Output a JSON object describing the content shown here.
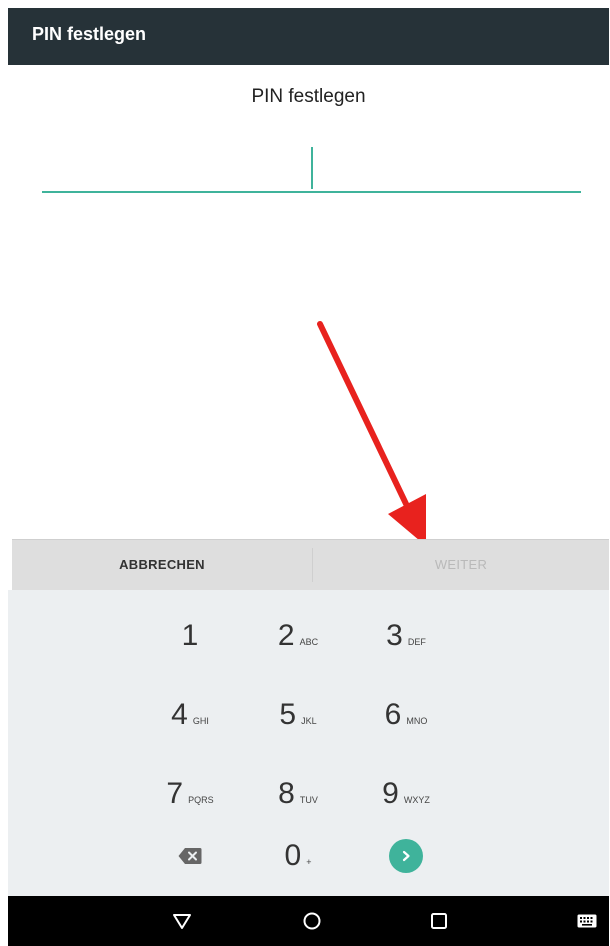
{
  "appbar": {
    "title": "PIN festlegen"
  },
  "prompt": {
    "text": "PIN festlegen"
  },
  "pin_input": {
    "value": ""
  },
  "actions": {
    "cancel_label": "ABBRECHEN",
    "next_label": "WEITER"
  },
  "keypad": {
    "keys": [
      {
        "digit": "1",
        "letters": ""
      },
      {
        "digit": "2",
        "letters": "ABC"
      },
      {
        "digit": "3",
        "letters": "DEF"
      },
      {
        "digit": "4",
        "letters": "GHI"
      },
      {
        "digit": "5",
        "letters": "JKL"
      },
      {
        "digit": "6",
        "letters": "MNO"
      },
      {
        "digit": "7",
        "letters": "PQRS"
      },
      {
        "digit": "8",
        "letters": "TUV"
      },
      {
        "digit": "9",
        "letters": "WXYZ"
      },
      {
        "digit": "0",
        "letters": "+"
      }
    ],
    "backspace_icon": "backspace-icon",
    "enter_icon": "chevron-right-icon"
  },
  "navbar": {
    "icons": [
      "back-icon",
      "home-icon",
      "recents-icon",
      "keyboard-icon"
    ]
  },
  "colors": {
    "appbar": "#263238",
    "accent": "#3fb39b",
    "keypad_bg": "#eceff1",
    "annotation_arrow": "#e8221e"
  }
}
